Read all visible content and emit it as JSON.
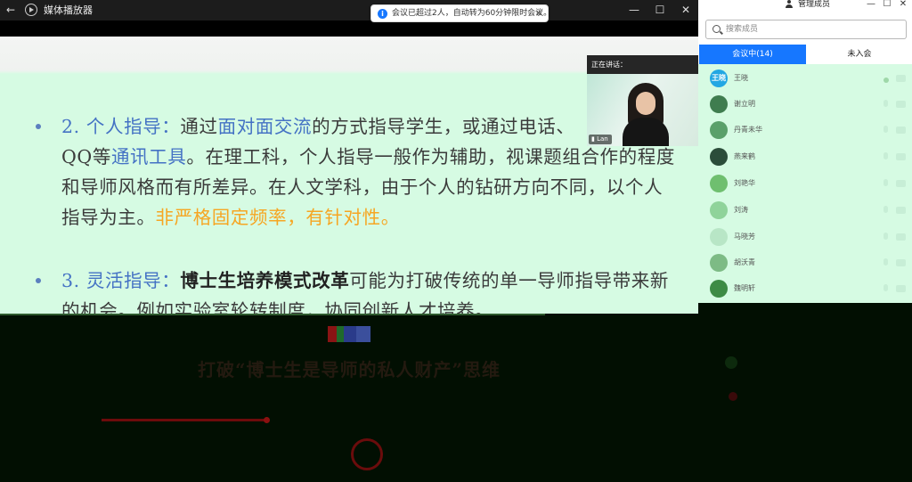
{
  "window": {
    "title": "媒体播放器",
    "back_glyph": "←",
    "minimize_glyph": "—",
    "maximize_glyph": "☐",
    "close_glyph": "✕"
  },
  "notice": {
    "text": "会议已超过2人，自动转为60分钟限时会议。",
    "info_glyph": "i",
    "close_glyph": "✕"
  },
  "slide": {
    "bullet2": {
      "num": "2.",
      "heading": "个人指导：",
      "t1": "通过",
      "h1": "面对面交流",
      "t2": "的方式指导学生，或通过电话、",
      "h2": "QQ",
      "t3": "等",
      "h3": "通讯工具",
      "t4": "。在理工科，个人指导一般作为辅助，视课题组合作的程度和导师风格而有所差异。在人文学科，由于个人的钻研方向不同，以个人指导为主。",
      "h4": "非严格固定频率，有针对性。"
    },
    "bullet3": {
      "num": "3.",
      "heading": "灵活指导：",
      "bold": "博士生培养模式改革",
      "t1": "可能为打破传统的单一导师指导带来新的机会。例如实验室轮转制度，协同创新人才培养。"
    }
  },
  "speaker": {
    "status": "正在讲话：",
    "name": "Lan",
    "mic_glyph": "🎙"
  },
  "lower_slide": {
    "title": "打破“博士生是导师的私人财产”思维"
  },
  "panel": {
    "title": "管理成员",
    "minimize_glyph": "—",
    "maximize_glyph": "☐",
    "close_glyph": "✕",
    "search_placeholder": "搜索成员",
    "tabs": [
      {
        "label": "会议中(14)",
        "active": true
      },
      {
        "label": "未入会",
        "active": false
      }
    ],
    "members": [
      {
        "name": "王晓",
        "avatar_text": "王晓",
        "avatar_color": "#23a7e3"
      },
      {
        "name": "谢立明",
        "avatar_text": "",
        "avatar_color": "#3f7d4f"
      },
      {
        "name": "丹青未华",
        "avatar_text": "",
        "avatar_color": "#5aa06a"
      },
      {
        "name": "燕来鹤",
        "avatar_text": "",
        "avatar_color": "#2b4d3a"
      },
      {
        "name": "刘艳华",
        "avatar_text": "",
        "avatar_color": "#6fbf6f"
      },
      {
        "name": "刘涛",
        "avatar_text": "",
        "avatar_color": "#8fd39a"
      },
      {
        "name": "马晓芳",
        "avatar_text": "",
        "avatar_color": "#b8e6c6"
      },
      {
        "name": "胡沃青",
        "avatar_text": "",
        "avatar_color": "#7dbb85"
      },
      {
        "name": "魏明轩",
        "avatar_text": "",
        "avatar_color": "#3d8b45"
      }
    ]
  },
  "colors": {
    "accent": "#1677ff",
    "slide_bg": "#d6fbe3",
    "heading_blue": "#4472c4",
    "highlight_orange": "#f6a623"
  }
}
